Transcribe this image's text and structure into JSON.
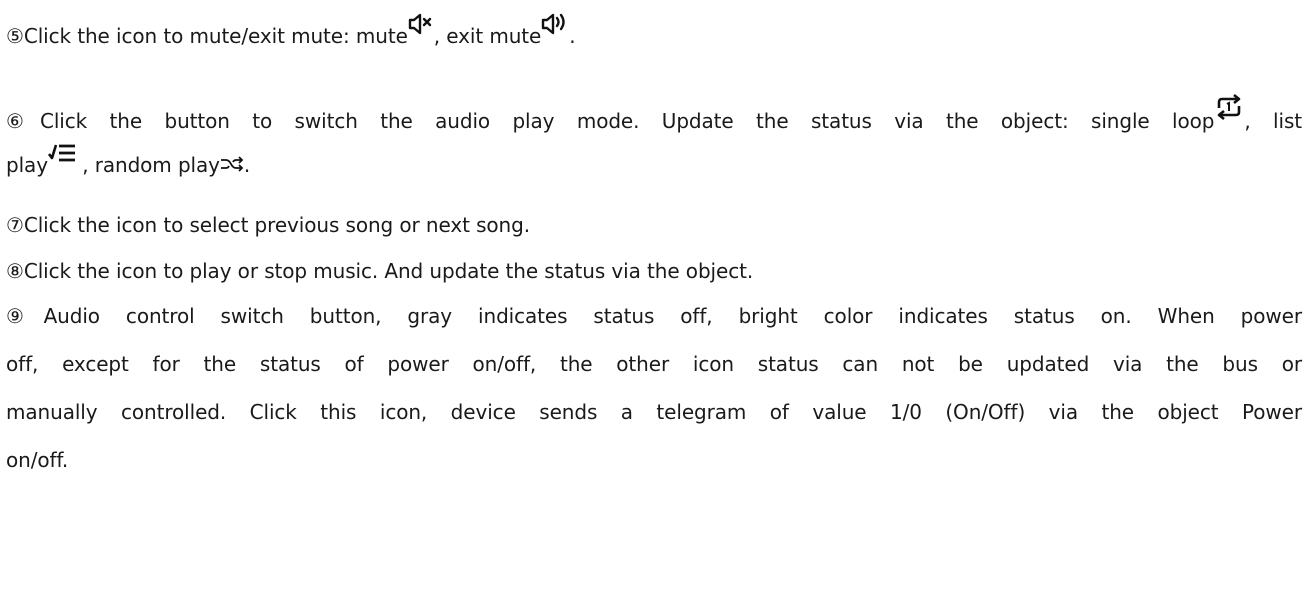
{
  "paragraphs": {
    "p5": {
      "text_a": "⑤Click the icon to mute/exit mute: mute",
      "text_b": ", exit mute",
      "text_c": ".",
      "icons": [
        "speaker-mute-icon",
        "speaker-sound-icon"
      ]
    },
    "p6": {
      "line1": "⑥Click the button to switch the audio play mode. Update the status via the object: single loop",
      "line1_end": ", list",
      "line2_a": "play",
      "line2_b": " , random play",
      "line2_c": ".",
      "icons": [
        "single-loop-icon",
        "list-play-icon",
        "random-play-icon"
      ]
    },
    "p7": {
      "text": "⑦Click the icon to select previous song or next song."
    },
    "p8": {
      "text": "⑧Click the icon to play or stop music. And update the status via the object."
    },
    "p9": {
      "line1": "⑨Audio control switch button, gray indicates status off, bright color indicates status on. When power",
      "line2": "off, except for the status of power on/off, the other icon status can not be updated via the bus or",
      "line3": "manually controlled. Click this icon, device sends a telegram of value 1/0 (On/Off) via the object Power",
      "line4": "on/off."
    }
  }
}
